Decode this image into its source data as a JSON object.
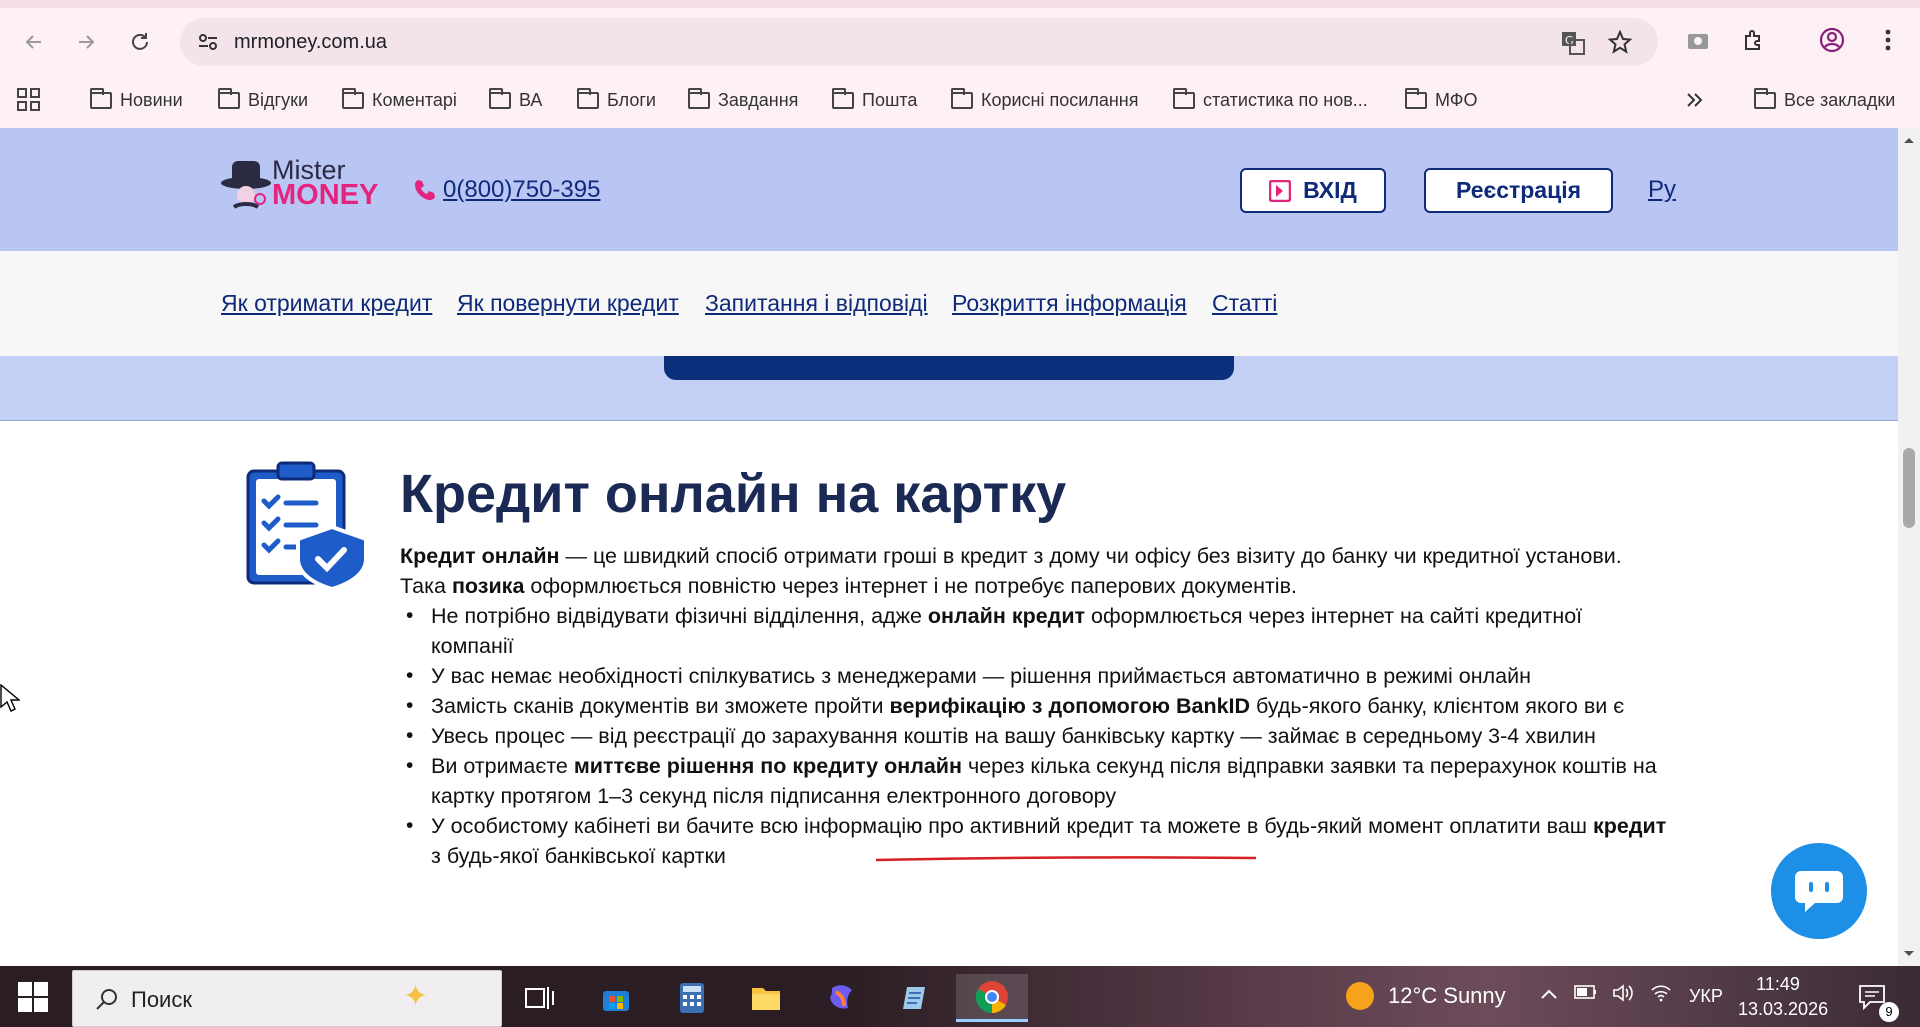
{
  "browser": {
    "url": "mrmoney.com.ua",
    "bookmarks": [
      "Новини",
      "Відгуки",
      "Коментарі",
      "ВА",
      "Блоги",
      "Завдання",
      "Пошта",
      "Корисні посилання",
      "статистика по нов...",
      "МФО"
    ],
    "all_bookmarks_label": "Все закладки",
    "icons": [
      "back-icon",
      "forward-icon",
      "reload-icon",
      "site-info-icon",
      "translate-icon",
      "star-icon",
      "camera-icon",
      "extensions-icon",
      "profile-icon",
      "menu-icon",
      "apps-icon",
      "more-bookmarks-icon"
    ]
  },
  "site": {
    "logo": {
      "line1": "Mister",
      "line2": "MONEY"
    },
    "phone": "0(800)750-395",
    "login_label": "ВХІД",
    "register_label": "Реєстрація",
    "lang_label": "Ру",
    "nav": [
      "Як отримати кредит",
      "Як повернути кредит",
      "Запитання і відповіді",
      "Розкриття інформація",
      "Статті"
    ]
  },
  "article": {
    "title": "Кредит онлайн на картку",
    "intro": [
      {
        "b": "Кредит онлайн"
      },
      {
        "t": " — це швидкий спосіб отримати гроші в кредит з дому чи офісу без візиту до банку чи кредитної установи. Така "
      },
      {
        "b": "позика"
      },
      {
        "t": " оформлюється повністю через інтернет і не потребує паперових документів."
      }
    ],
    "bullets": [
      [
        {
          "t": "Не потрібно відвідувати фізичні відділення, адже "
        },
        {
          "b": "онлайн кредит"
        },
        {
          "t": " оформлюється через інтернет на сайті кредитної компанії"
        }
      ],
      [
        {
          "t": "У вас немає необхідності спілкуватись з менеджерами — рішення приймається автоматично в режимі онлайн"
        }
      ],
      [
        {
          "t": "Замість сканів документів ви зможете пройти "
        },
        {
          "b": "верифікацію з допомогою BankID"
        },
        {
          "t": " будь-якого банку, клієнтом якого ви є"
        }
      ],
      [
        {
          "t": "Увесь процес — від реєстрації до зарахування коштів на вашу банківську картку — займає в середньому 3-4 хвилин"
        }
      ],
      [
        {
          "t": "Ви отримаєте "
        },
        {
          "b": "миттєве рішення по кредиту онлайн"
        },
        {
          "t": " через кілька секунд після відправки заявки та перерахунок коштів на картку протягом 1–3 секунд після підписання електронного договору"
        }
      ],
      [
        {
          "t": "У особистому кабінеті ви бачите всю інформацію про активний кредит та можете в будь-який момент оплатити ваш "
        },
        {
          "b": "кредит"
        },
        {
          "t": " з будь-якої банківської картки"
        }
      ]
    ]
  },
  "taskbar": {
    "search_placeholder": "Поиск",
    "weather": "12°C  Sunny",
    "lang": "УКР",
    "time": "11:49",
    "date": "13.03.2026",
    "notifications": "9"
  },
  "colors": {
    "header_bg": "#b9c6f4",
    "brand_navy": "#0f2a7a",
    "brand_pink": "#e5247e",
    "chat": "#1d8fe6"
  }
}
